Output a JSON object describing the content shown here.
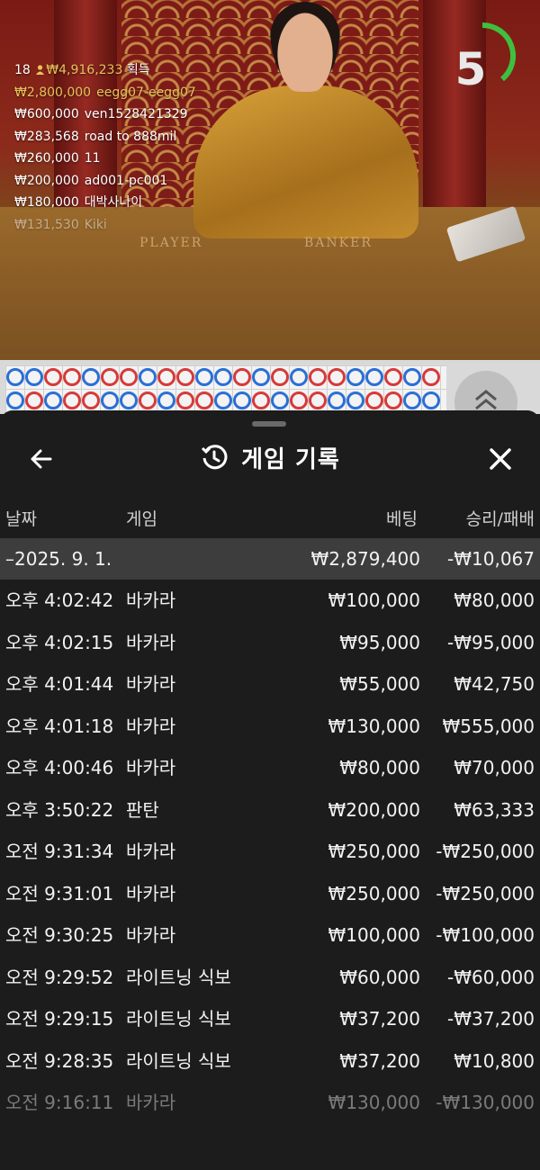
{
  "stream": {
    "table_labels": {
      "player": "PLAYER",
      "banker": "BANKER"
    },
    "countdown": "5",
    "winners": {
      "count": "18",
      "total": "₩4,916,233",
      "suffix": "획득",
      "list": [
        {
          "amount": "₩2,800,000",
          "name": "eegg07-eegg07",
          "highlight": true
        },
        {
          "amount": "₩600,000",
          "name": "ven1528421329",
          "highlight": false
        },
        {
          "amount": "₩283,568",
          "name": "road to 888mil",
          "highlight": false
        },
        {
          "amount": "₩260,000",
          "name": "11",
          "highlight": false
        },
        {
          "amount": "₩200,000",
          "name": "ad001-pc001",
          "highlight": false
        },
        {
          "amount": "₩180,000",
          "name": "대박사나이",
          "highlight": false
        },
        {
          "amount": "₩131,530",
          "name": "Kiki",
          "highlight": false
        }
      ]
    }
  },
  "colors": {
    "accent_gold": "#e8c35a",
    "timer_green": "#3fbf3f",
    "player_blue": "#2a6fd6",
    "banker_red": "#d63a3a"
  },
  "sheet": {
    "title": "게임 기록",
    "icons": {
      "back": "arrow-left-icon",
      "history": "history-clock-icon",
      "close": "close-icon",
      "expand": "chevron-double-up-icon"
    },
    "columns": {
      "date": "날짜",
      "game": "게임",
      "bet": "베팅",
      "result": "승리/패배"
    },
    "summary": {
      "date": "–2025. 9. 1.",
      "bet": "₩2,879,400",
      "result": "-₩10,067"
    },
    "rows": [
      {
        "time": "오후 4:02:42",
        "game": "바카라",
        "bet": "₩100,000",
        "result": "₩80,000"
      },
      {
        "time": "오후 4:02:15",
        "game": "바카라",
        "bet": "₩95,000",
        "result": "-₩95,000"
      },
      {
        "time": "오후 4:01:44",
        "game": "바카라",
        "bet": "₩55,000",
        "result": "₩42,750"
      },
      {
        "time": "오후 4:01:18",
        "game": "바카라",
        "bet": "₩130,000",
        "result": "₩555,000"
      },
      {
        "time": "오후 4:00:46",
        "game": "바카라",
        "bet": "₩80,000",
        "result": "₩70,000"
      },
      {
        "time": "오후 3:50:22",
        "game": "판탄",
        "bet": "₩200,000",
        "result": "₩63,333"
      },
      {
        "time": "오전 9:31:34",
        "game": "바카라",
        "bet": "₩250,000",
        "result": "-₩250,000"
      },
      {
        "time": "오전 9:31:01",
        "game": "바카라",
        "bet": "₩250,000",
        "result": "-₩250,000"
      },
      {
        "time": "오전 9:30:25",
        "game": "바카라",
        "bet": "₩100,000",
        "result": "-₩100,000"
      },
      {
        "time": "오전 9:29:52",
        "game": "라이트닝 식보",
        "bet": "₩60,000",
        "result": "-₩60,000"
      },
      {
        "time": "오전 9:29:15",
        "game": "라이트닝 식보",
        "bet": "₩37,200",
        "result": "-₩37,200"
      },
      {
        "time": "오전 9:28:35",
        "game": "라이트닝 식보",
        "bet": "₩37,200",
        "result": "₩10,800"
      },
      {
        "time": "오전 9:16:11",
        "game": "바카라",
        "bet": "₩130,000",
        "result": "-₩130,000"
      }
    ]
  }
}
